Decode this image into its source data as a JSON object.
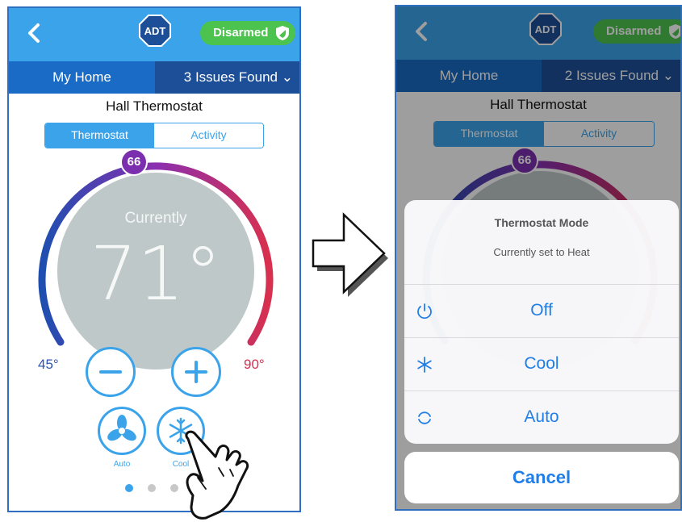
{
  "left": {
    "header": {
      "badge_label": "Disarmed"
    },
    "subbar": {
      "home": "My Home",
      "issues": "3 Issues Found"
    },
    "device_title": "Hall Thermostat",
    "tabs": [
      {
        "label": "Thermostat",
        "active": true
      },
      {
        "label": "Activity",
        "active": false
      }
    ],
    "dial": {
      "setpoint": "66",
      "current_label": "Currently",
      "current_temp": "71°",
      "min_label": "45°",
      "max_label": "90°"
    },
    "modes": [
      {
        "label": "Auto",
        "icon": "fan-icon"
      },
      {
        "label": "Cool",
        "icon": "snowflake-icon"
      }
    ],
    "pager": {
      "count": 3,
      "active": 0
    }
  },
  "right": {
    "header": {
      "badge_label": "Disarmed"
    },
    "subbar": {
      "home": "My Home",
      "issues": "2 Issues Found"
    },
    "device_title": "Hall Thermostat",
    "tabs": [
      {
        "label": "Thermostat",
        "active": true
      },
      {
        "label": "Activity",
        "active": false
      }
    ],
    "dial": {
      "setpoint": "66"
    },
    "sheet": {
      "title": "Thermostat Mode",
      "subtitle": "Currently set to Heat",
      "options": [
        {
          "label": "Off",
          "icon": "power-icon"
        },
        {
          "label": "Cool",
          "icon": "snowflake-icon"
        },
        {
          "label": "Auto",
          "icon": "auto-cycle-icon"
        }
      ],
      "cancel": "Cancel"
    }
  },
  "colors": {
    "accent": "#3ba3ea",
    "brand_blue": "#1a6bc5",
    "armed_green": "#4cc34f",
    "dial_gray": "#bfc8c8",
    "ios_blue": "#1f7ee8"
  }
}
